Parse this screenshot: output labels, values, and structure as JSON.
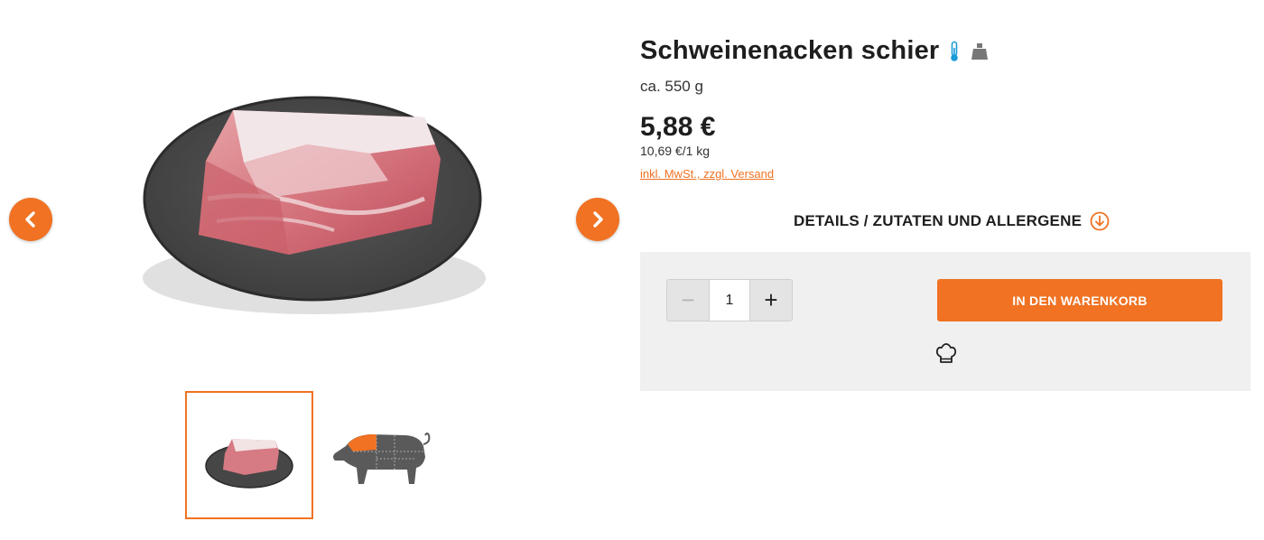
{
  "product": {
    "title": "Schweinenacken schier",
    "weight": "ca. 550 g",
    "price": "5,88 €",
    "unit_price": "10,69 €/1 kg",
    "tax_note": "inkl. MwSt., zzgl. Versand",
    "badges": [
      "thermometer-icon",
      "weight-icon"
    ]
  },
  "details": {
    "label": "DETAILS / ZUTATEN UND ALLERGENE"
  },
  "cart": {
    "quantity": "1",
    "minus_label": "−",
    "plus_label": "+",
    "add_label": "IN DEN WARENKORB"
  },
  "gallery": {
    "prev_icon": "chevron-left-icon",
    "next_icon": "chevron-right-icon",
    "thumbnails": [
      "meat-on-slate",
      "pig-cut-diagram"
    ]
  },
  "colors": {
    "accent": "#f07222",
    "box_bg": "#f0f0f0",
    "icon_blue": "#1a9bd7"
  }
}
